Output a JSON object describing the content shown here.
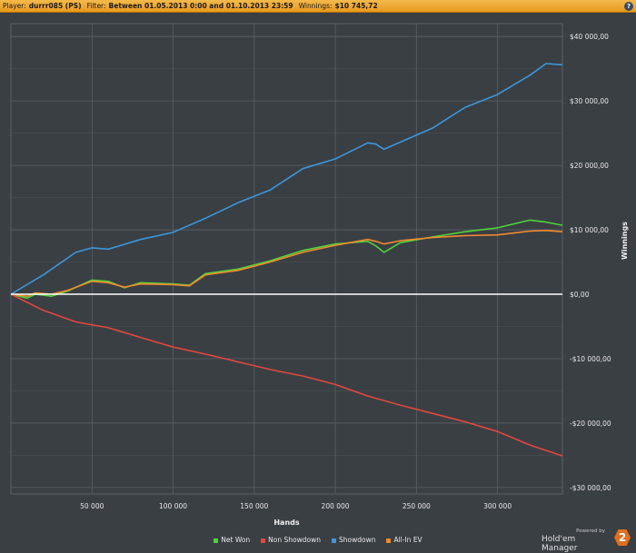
{
  "header": {
    "player_label": "Player:",
    "player_value": "durrr085 (PS)",
    "filter_label": "Filter:",
    "filter_value": "Between 01.05.2013 0:00 and 01.10.2013 23:59",
    "winnings_label": "Winnings:",
    "winnings_value": "$10 745,72",
    "help_symbol": "?"
  },
  "brand": {
    "powered": "Powered by",
    "name": "Hold'em Manager",
    "logo": "2"
  },
  "colors": {
    "net_won": "#4fd33a",
    "non_showdown": "#e2473d",
    "showdown": "#3b97dc",
    "allin_ev": "#f28a2e",
    "zero_line": "#ffffff",
    "grid": "#5a6066",
    "plot_bg": "#3a3f44"
  },
  "chart_data": {
    "type": "line",
    "xlabel": "Hands",
    "ylabel": "Winnings",
    "xlim": [
      0,
      340000
    ],
    "ylim": [
      -31000,
      42000
    ],
    "xticks": [
      50000,
      100000,
      150000,
      200000,
      250000,
      300000
    ],
    "xtick_labels": [
      "50 000",
      "100 000",
      "150 000",
      "200 000",
      "250 000",
      "300 000"
    ],
    "yticks": [
      40000,
      30000,
      20000,
      10000,
      0,
      -10000,
      -20000,
      -30000
    ],
    "ytick_labels": [
      "$40 000,00",
      "$30 000,00",
      "$20 000,00",
      "$10 000,00",
      "$0,00",
      "-$10 000,00",
      "-$20 000,00",
      "-$30 000,00"
    ],
    "grid": true,
    "legend_position": "bottom",
    "series": [
      {
        "name": "Showdown",
        "color_key": "showdown",
        "x": [
          0,
          20000,
          40000,
          50000,
          60000,
          80000,
          100000,
          120000,
          130000,
          140000,
          160000,
          180000,
          200000,
          220000,
          225000,
          230000,
          260000,
          280000,
          300000,
          320000,
          330000,
          340000
        ],
        "y": [
          0,
          3000,
          6500,
          7200,
          7000,
          8500,
          9600,
          11800,
          13000,
          14200,
          16200,
          19500,
          21000,
          23500,
          23300,
          22500,
          25800,
          29000,
          31000,
          34000,
          35800,
          35600
        ]
      },
      {
        "name": "Net Won",
        "color_key": "net_won",
        "x": [
          0,
          10000,
          15000,
          25000,
          35000,
          50000,
          60000,
          70000,
          80000,
          100000,
          110000,
          120000,
          140000,
          160000,
          180000,
          200000,
          220000,
          225000,
          230000,
          240000,
          260000,
          280000,
          300000,
          320000,
          330000,
          340000
        ],
        "y": [
          0,
          -600,
          0,
          -300,
          500,
          2200,
          2000,
          1000,
          1800,
          1600,
          1400,
          3200,
          3900,
          5200,
          6800,
          7800,
          8200,
          7500,
          6500,
          8000,
          8900,
          9700,
          10300,
          11500,
          11200,
          10700
        ]
      },
      {
        "name": "All-In EV",
        "color_key": "allin_ev",
        "x": [
          0,
          10000,
          15000,
          25000,
          35000,
          50000,
          60000,
          70000,
          80000,
          100000,
          110000,
          120000,
          140000,
          160000,
          180000,
          200000,
          220000,
          225000,
          230000,
          240000,
          260000,
          280000,
          300000,
          320000,
          330000,
          340000
        ],
        "y": [
          0,
          -300,
          200,
          0,
          600,
          2000,
          1800,
          1100,
          1600,
          1500,
          1300,
          3000,
          3700,
          5000,
          6500,
          7600,
          8500,
          8200,
          7800,
          8300,
          8800,
          9100,
          9200,
          9800,
          9900,
          9700
        ]
      },
      {
        "name": "Non Showdown",
        "color_key": "non_showdown",
        "x": [
          0,
          20000,
          40000,
          60000,
          80000,
          100000,
          120000,
          140000,
          160000,
          180000,
          200000,
          220000,
          240000,
          260000,
          280000,
          300000,
          320000,
          340000
        ],
        "y": [
          0,
          -2500,
          -4300,
          -5200,
          -6700,
          -8200,
          -9300,
          -10500,
          -11700,
          -12700,
          -14000,
          -15800,
          -17200,
          -18500,
          -19800,
          -21300,
          -23400,
          -25100
        ]
      }
    ]
  }
}
